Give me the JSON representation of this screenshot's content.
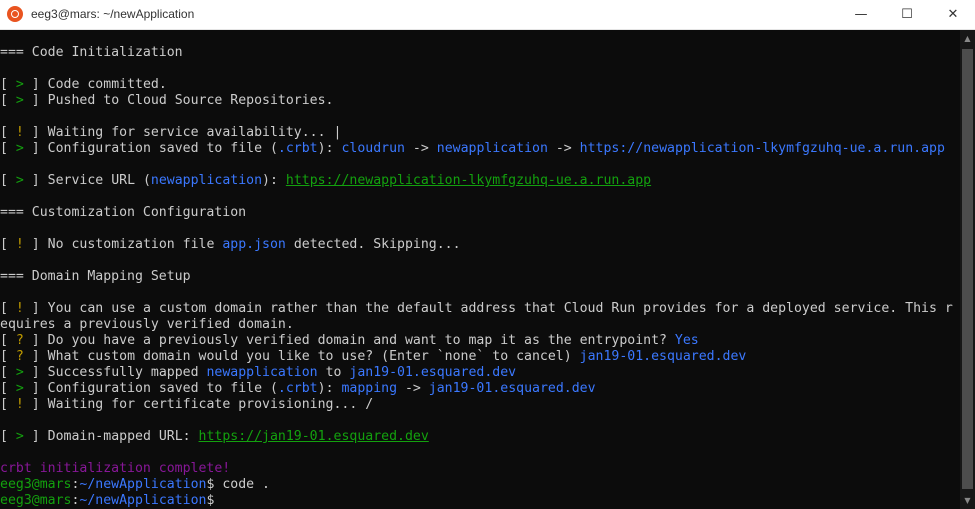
{
  "window": {
    "title": "eeg3@mars: ~/newApplication",
    "minimize": "—",
    "maximize": "☐",
    "close": "✕"
  },
  "colors": {
    "green": "#13a10e",
    "yellow": "#c19c00",
    "blue": "#3b78ff",
    "purple": "#881798",
    "text": "#cccccc",
    "background": "#0c0c0c"
  },
  "terminal": {
    "heading_init": "=== Code Initialization",
    "l_committed": "Code committed.",
    "l_pushed": "Pushed to Cloud Source Repositories.",
    "l_waiting": "Waiting for service availability... |",
    "l_config1_a": "Configuration saved to file (",
    "crbt": ".crbt",
    "l_config_b": "): ",
    "cloudrun": "cloudrun",
    "arrow": " -> ",
    "newapplication": "newapplication",
    "run_url": "https://newapplication-lkymfgzuhq-ue.a.run.app",
    "l_service_a": "Service URL (",
    "l_service_b": "): ",
    "heading_custom": "=== Customization Configuration",
    "l_nocustom_a": "No customization file ",
    "appjson": "app.json",
    "l_nocustom_b": " detected. Skipping...",
    "heading_domain": "=== Domain Mapping Setup",
    "l_canuse": "You can use a custom domain rather than the default address that Cloud Run provides for a deployed service. This r",
    "l_requires": "equires a previously verified domain.",
    "l_q1": "Do you have a previously verified domain and want to map it as the entrypoint? ",
    "yes": "Yes",
    "l_q2": "What custom domain would you like to use? (Enter `none` to cancel) ",
    "domain": "jan19-01.esquared.dev",
    "l_mapped_a": "Successfully mapped ",
    "to": " to ",
    "mapping": "mapping",
    "l_cert": "Waiting for certificate provisioning... /",
    "l_domain_url": "Domain-mapped URL: ",
    "domain_url": "https://jan19-01.esquared.dev",
    "complete": "crbt initialization complete!",
    "prompt_user": "eeg3@mars",
    "prompt_path": "~/newApplication",
    "cmd": " code .",
    "mark_ok": ">",
    "mark_warn": "!",
    "mark_q": "?"
  }
}
